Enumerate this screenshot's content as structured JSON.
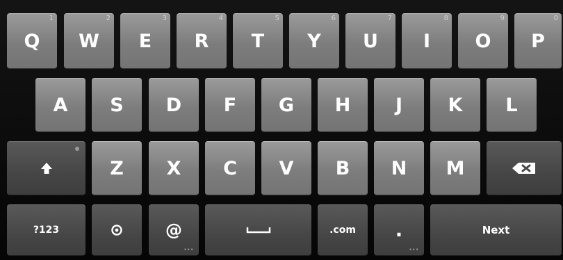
{
  "keyboard": {
    "row1": [
      {
        "letter": "Q",
        "hint": "1"
      },
      {
        "letter": "W",
        "hint": "2"
      },
      {
        "letter": "E",
        "hint": "3"
      },
      {
        "letter": "R",
        "hint": "4"
      },
      {
        "letter": "T",
        "hint": "5"
      },
      {
        "letter": "Y",
        "hint": "6"
      },
      {
        "letter": "U",
        "hint": "7"
      },
      {
        "letter": "I",
        "hint": "8"
      },
      {
        "letter": "O",
        "hint": "9"
      },
      {
        "letter": "P",
        "hint": "0"
      }
    ],
    "row2": [
      "A",
      "S",
      "D",
      "F",
      "G",
      "H",
      "J",
      "K",
      "L"
    ],
    "row3": [
      "Z",
      "X",
      "C",
      "V",
      "B",
      "N",
      "M"
    ],
    "bottom": {
      "symbols_label": "?123",
      "at_label": "@",
      "dotcom_label": ".com",
      "period_label": ".",
      "next_label": "Next"
    },
    "icons": {
      "shift": "shift-arrow-icon",
      "mic": "microphone-settings-icon",
      "space": "space-bar-icon",
      "backspace": "backspace-icon"
    }
  }
}
